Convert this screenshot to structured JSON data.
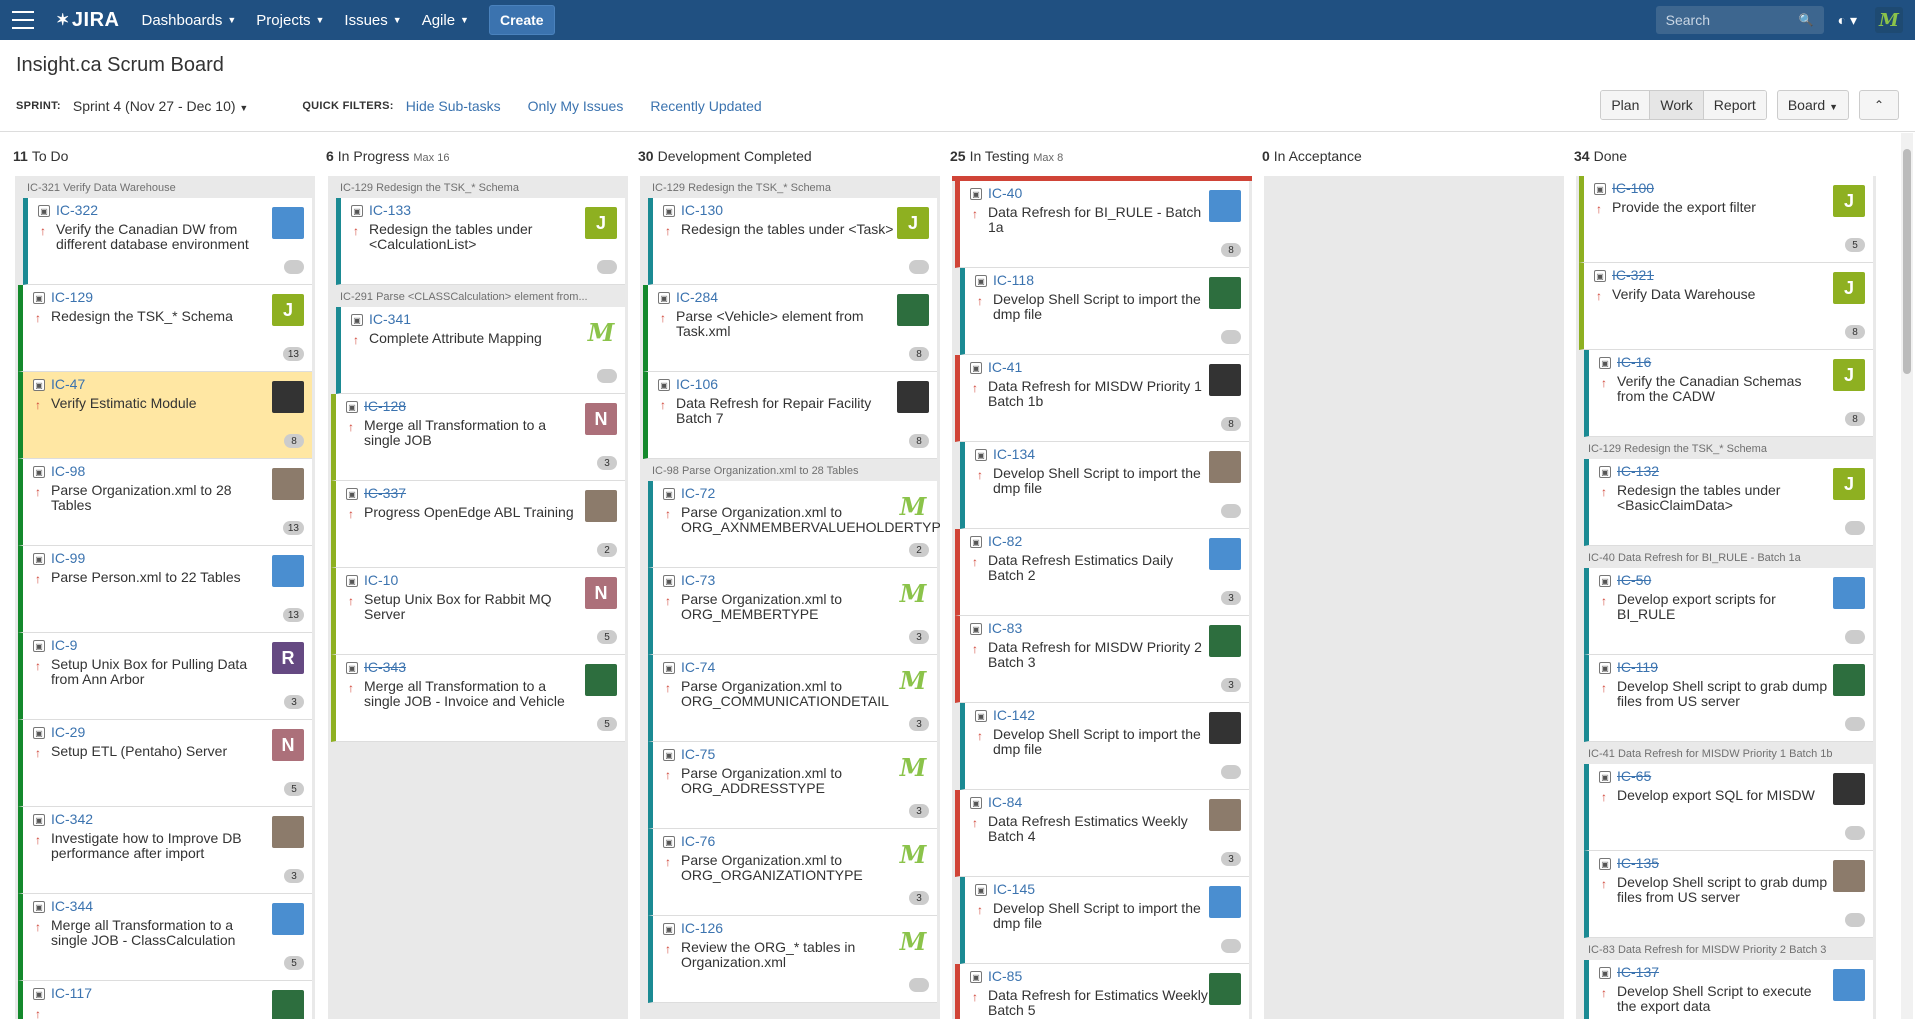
{
  "nav": {
    "logo": "JIRA",
    "items": [
      "Dashboards",
      "Projects",
      "Issues",
      "Agile"
    ],
    "create": "Create",
    "search_placeholder": "Search"
  },
  "header": {
    "title": "Insight.ca Scrum Board",
    "sprint_label": "SPRINT:",
    "sprint_value": "Sprint 4 (Nov 27 - Dec 10)",
    "quick_filters_label": "QUICK FILTERS:",
    "quick_filters": [
      "Hide Sub-tasks",
      "Only My Issues",
      "Recently Updated"
    ],
    "modes": [
      "Plan",
      "Work",
      "Report"
    ],
    "board_button": "Board"
  },
  "columns": [
    {
      "count": "11",
      "name": "To Do",
      "max": ""
    },
    {
      "count": "6",
      "name": "In Progress",
      "max": "Max 16"
    },
    {
      "count": "30",
      "name": "Development Completed",
      "max": ""
    },
    {
      "count": "25",
      "name": "In Testing",
      "max": "Max 8"
    },
    {
      "count": "0",
      "name": "In Acceptance",
      "max": ""
    },
    {
      "count": "34",
      "name": "Done",
      "max": ""
    }
  ],
  "cards": {
    "todo": [
      {
        "swim": "IC-321  Verify Data Warehouse"
      },
      {
        "key": "IC-322",
        "summary": "Verify the Canadian DW from different database environment",
        "est": "",
        "sub": true
      },
      {
        "key": "IC-129",
        "summary": "Redesign the TSK_* Schema",
        "est": "13",
        "av": "J"
      },
      {
        "key": "IC-47",
        "summary": "Verify Estimatic Module",
        "est": "8",
        "flag": true
      },
      {
        "key": "IC-98",
        "summary": "Parse Organization.xml to 28 Tables",
        "est": "13"
      },
      {
        "key": "IC-99",
        "summary": "Parse Person.xml to 22 Tables",
        "est": "13"
      },
      {
        "key": "IC-9",
        "summary": "Setup Unix Box for Pulling Data from Ann Arbor",
        "est": "3",
        "av": "R"
      },
      {
        "key": "IC-29",
        "summary": "Setup ETL (Pentaho) Server",
        "est": "5",
        "av": "N"
      },
      {
        "key": "IC-342",
        "summary": "Investigate how to Improve DB performance after import",
        "est": "3"
      },
      {
        "key": "IC-344",
        "summary": "Merge all Transformation to a single JOB - ClassCalculation",
        "est": "5"
      },
      {
        "key": "IC-117",
        "summary": "",
        "est": ""
      }
    ],
    "inprogress": [
      {
        "swim": "IC-129  Redesign the TSK_* Schema"
      },
      {
        "key": "IC-133",
        "summary": "Redesign the tables under <CalculationList>",
        "est": "",
        "av": "J",
        "sub": true
      },
      {
        "swim": "IC-291  Parse <CLASSCalculation> element from..."
      },
      {
        "key": "IC-341",
        "summary": "Complete Attribute Mapping",
        "est": "",
        "av": "M",
        "sub": true
      },
      {
        "key": "IC-128",
        "summary": "Merge all Transformation to a single JOB",
        "est": "3",
        "av": "N",
        "done": true
      },
      {
        "key": "IC-337",
        "summary": "Progress OpenEdge ABL Training",
        "est": "2",
        "done": true
      },
      {
        "key": "IC-10",
        "summary": "Setup Unix Box for Rabbit MQ Server",
        "est": "5",
        "av": "N"
      },
      {
        "key": "IC-343",
        "summary": "Merge all Transformation to a single JOB - Invoice and Vehicle",
        "est": "5",
        "done": true
      }
    ],
    "devdone": [
      {
        "swim": "IC-129  Redesign the TSK_* Schema"
      },
      {
        "key": "IC-130",
        "summary": "Redesign the tables under <Task>",
        "est": "",
        "av": "J",
        "sub": true
      },
      {
        "key": "IC-284",
        "summary": "Parse <Vehicle> element from Task.xml",
        "est": "8"
      },
      {
        "key": "IC-106",
        "summary": "Data Refresh for Repair Facility Batch 7",
        "est": "8"
      },
      {
        "swim": "IC-98  Parse Organization.xml to 28 Tables"
      },
      {
        "key": "IC-72",
        "summary": "Parse Organization.xml to ORG_AXNMEMBERVALUEHOLDERTYPE",
        "est": "2",
        "av": "M",
        "sub": true
      },
      {
        "key": "IC-73",
        "summary": "Parse Organization.xml to ORG_MEMBERTYPE",
        "est": "3",
        "av": "M",
        "sub": true
      },
      {
        "key": "IC-74",
        "summary": "Parse Organization.xml to ORG_COMMUNICATIONDETAIL",
        "est": "3",
        "av": "M",
        "sub": true
      },
      {
        "key": "IC-75",
        "summary": "Parse Organization.xml to ORG_ADDRESSTYPE",
        "est": "3",
        "av": "M",
        "sub": true
      },
      {
        "key": "IC-76",
        "summary": "Parse Organization.xml to ORG_ORGANIZATIONTYPE",
        "est": "3",
        "av": "M",
        "sub": true
      },
      {
        "key": "IC-126",
        "summary": "Review the ORG_* tables in Organization.xml",
        "est": "",
        "av": "M",
        "sub": true
      }
    ],
    "testing": [
      {
        "key": "IC-40",
        "summary": "Data Refresh for BI_RULE - Batch 1a",
        "est": "8"
      },
      {
        "key": "IC-118",
        "summary": "Develop Shell Script to import the dmp file",
        "est": "",
        "sub": true
      },
      {
        "key": "IC-41",
        "summary": "Data Refresh for MISDW Priority 1 Batch 1b",
        "est": "8"
      },
      {
        "key": "IC-134",
        "summary": "Develop Shell Script to import the dmp file",
        "est": "",
        "sub": true
      },
      {
        "key": "IC-82",
        "summary": "Data Refresh Estimatics Daily Batch 2",
        "est": "3"
      },
      {
        "key": "IC-83",
        "summary": "Data Refresh for MISDW Priority 2 Batch 3",
        "est": "3"
      },
      {
        "key": "IC-142",
        "summary": "Develop Shell Script to import the dmp file",
        "est": "",
        "sub": true
      },
      {
        "key": "IC-84",
        "summary": "Data Refresh Estimatics Weekly Batch 4",
        "est": "3"
      },
      {
        "key": "IC-145",
        "summary": "Develop Shell Script to import the dmp file",
        "est": "",
        "sub": true
      },
      {
        "key": "IC-85",
        "summary": "Data Refresh for Estimatics Weekly Batch 5",
        "est": ""
      }
    ],
    "done": [
      {
        "key": "IC-100",
        "summary": "Provide the export filter",
        "est": "5",
        "av": "J",
        "done": true
      },
      {
        "key": "IC-321",
        "summary": "Verify Data Warehouse",
        "est": "8",
        "av": "J",
        "done": true
      },
      {
        "key": "IC-16",
        "summary": "Verify the Canadian Schemas from the CADW",
        "est": "8",
        "av": "J",
        "done": true,
        "sub": true
      },
      {
        "swim": "IC-129  Redesign the TSK_* Schema"
      },
      {
        "key": "IC-132",
        "summary": "Redesign the tables under <BasicClaimData>",
        "est": "",
        "av": "J",
        "done": true,
        "sub": true
      },
      {
        "swim": "IC-40  Data Refresh for BI_RULE - Batch 1a"
      },
      {
        "key": "IC-50",
        "summary": "Develop export scripts for BI_RULE",
        "est": "",
        "done": true,
        "sub": true
      },
      {
        "key": "IC-119",
        "summary": "Develop Shell script to grab dump files from US server",
        "est": "",
        "done": true,
        "sub": true
      },
      {
        "swim": "IC-41  Data Refresh for MISDW Priority 1 Batch 1b"
      },
      {
        "key": "IC-65",
        "summary": "Develop export SQL for MISDW",
        "est": "",
        "done": true,
        "sub": true
      },
      {
        "key": "IC-135",
        "summary": "Develop Shell script to grab dump files from US server",
        "est": "",
        "done": true,
        "sub": true
      },
      {
        "swim": "IC-83  Data Refresh for MISDW Priority 2 Batch 3"
      },
      {
        "key": "IC-137",
        "summary": "Develop Shell Script to execute the export data",
        "est": "",
        "done": true,
        "sub": true
      }
    ]
  }
}
